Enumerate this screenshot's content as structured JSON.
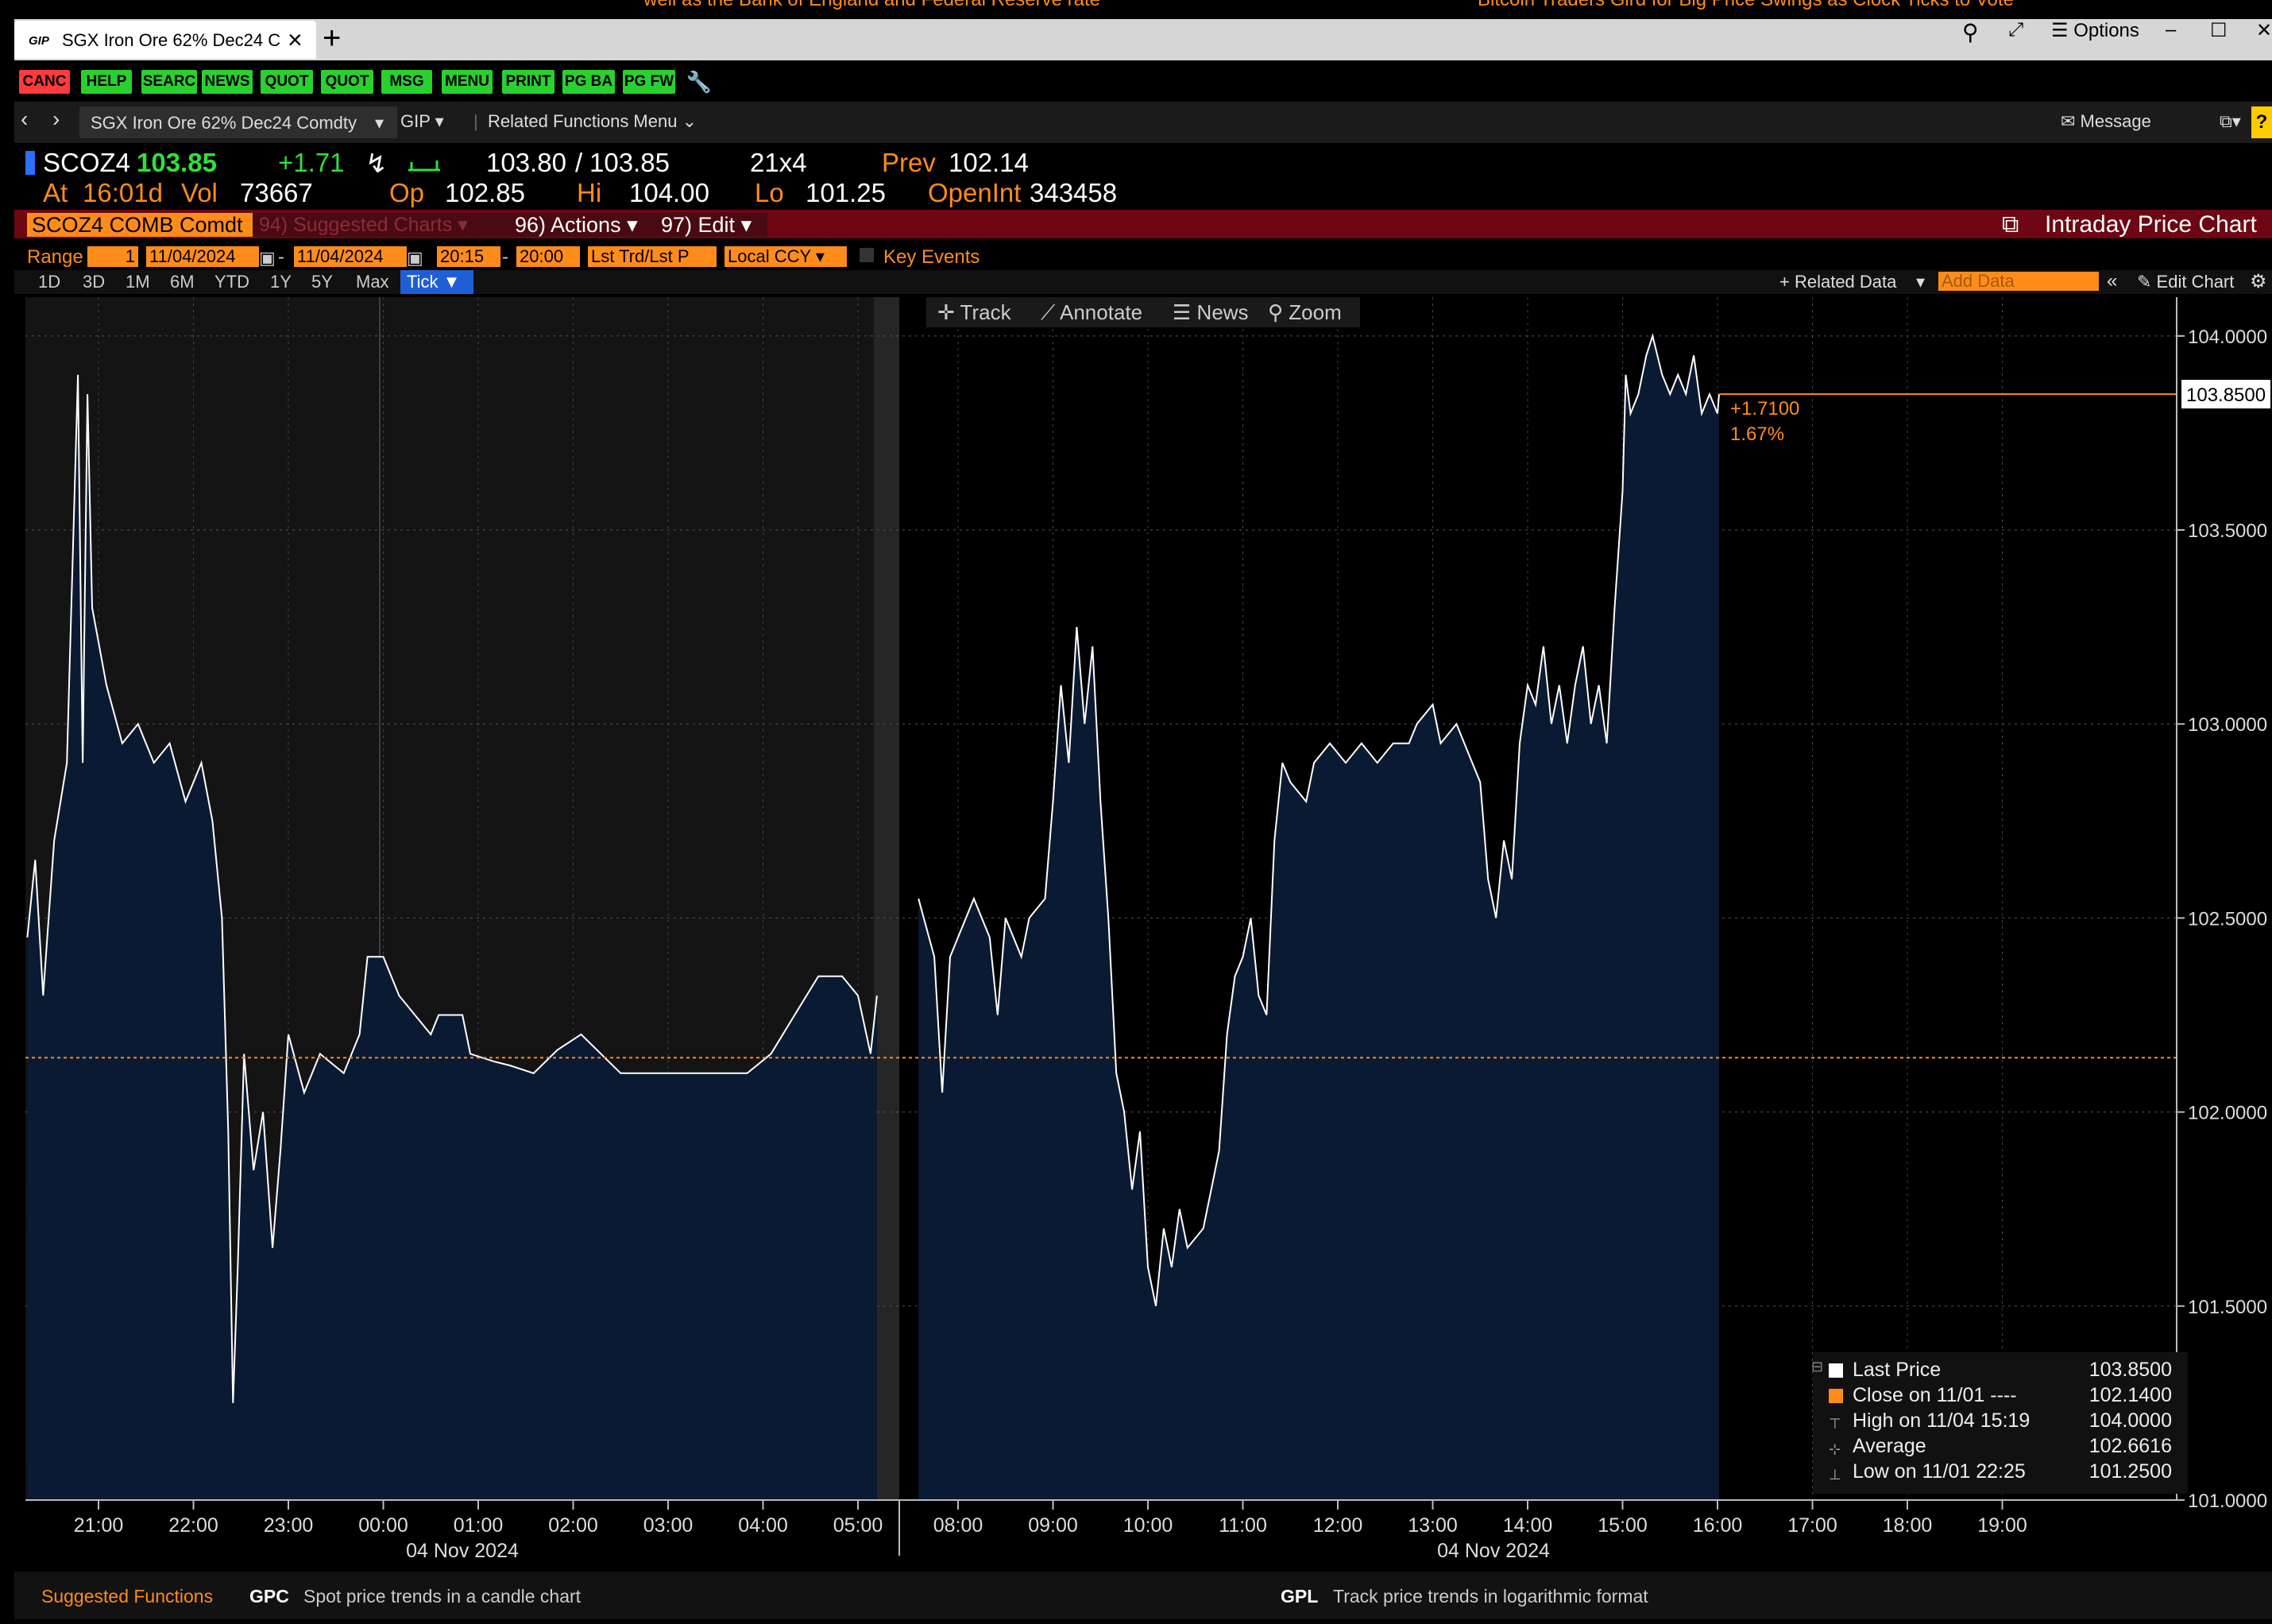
{
  "ticker": {
    "left_text": "well as the Bank of England and Federal Reserve rate",
    "right_text": "Bitcoin Traders Gird for Big Price Swings as Clock Ticks to Vote"
  },
  "tab": {
    "logo": "GIP",
    "title": "SGX Iron Ore 62% Dec24 C",
    "close": "×",
    "new_tab": "+"
  },
  "window_controls": {
    "options_label": "Options"
  },
  "toolbar": {
    "buttons": [
      {
        "label": "CANC",
        "color": "#ff3b3b"
      },
      {
        "label": "HELP",
        "color": "#29d12f"
      },
      {
        "label": "SEARC",
        "color": "#29d12f"
      },
      {
        "label": "NEWS",
        "color": "#29d12f"
      },
      {
        "label": "QUOT",
        "color": "#29d12f"
      },
      {
        "label": "QUOT",
        "color": "#29d12f"
      },
      {
        "label": "MSG",
        "color": "#29d12f"
      },
      {
        "label": "MENU",
        "color": "#29d12f"
      },
      {
        "label": "PRINT",
        "color": "#29d12f"
      },
      {
        "label": "PG BA",
        "color": "#29d12f"
      },
      {
        "label": "PG FW",
        "color": "#29d12f"
      }
    ]
  },
  "navbar": {
    "security": "SGX Iron Ore 62% Dec24 Comdty",
    "function": "GIP",
    "related": "Related Functions Menu",
    "message": "Message"
  },
  "quote": {
    "ticker": "SCOZ4",
    "last": "103.85",
    "change": "+1.71",
    "bid": "103.80",
    "ask": "103.85",
    "size": "21x4",
    "prev_label": "Prev",
    "prev": "102.14",
    "at_label": "At",
    "at_time": "16:01d",
    "vol_label": "Vol",
    "vol": "73667",
    "op_label": "Op",
    "op": "102.85",
    "hi_label": "Hi",
    "hi": "104.00",
    "lo_label": "Lo",
    "lo": "101.25",
    "oi_label": "OpenInt",
    "oi": "343458"
  },
  "actionbar": {
    "security_field": "SCOZ4 COMB Comdt",
    "suggested": "94) Suggested Charts",
    "actions": "96) Actions",
    "edit": "97) Edit",
    "title": "Intraday Price Chart"
  },
  "rangebar": {
    "range_label": "Range",
    "range_val": "1",
    "date_from": "11/04/2024",
    "date_to": "11/04/2024",
    "time_from": "20:15",
    "time_to": "20:00",
    "price_type": "Lst Trd/Lst P",
    "currency": "Local CCY",
    "key_events": "Key Events"
  },
  "periods": [
    "1D",
    "3D",
    "1M",
    "6M",
    "YTD",
    "1Y",
    "5Y",
    "Max"
  ],
  "tick_label": "Tick",
  "chart_tools": {
    "related_data": "+ Related Data",
    "add_data": "Add Data",
    "edit_chart": "Edit Chart",
    "track": "Track",
    "annotate": "Annotate",
    "news": "News",
    "zoom": "Zoom"
  },
  "colors": {
    "accent_orange": "#ff8c1a",
    "area_fill": "#0a1a33",
    "price_line": "#ffffff",
    "up_green": "#2fe03a",
    "action_bar": "#6e0613"
  },
  "chart_data": {
    "type": "area",
    "ylim": [
      101.0,
      104.1
    ],
    "y_ticks": [
      "104.0000",
      "103.5000",
      "103.0000",
      "102.5000",
      "102.0000",
      "101.5000",
      "101.0000"
    ],
    "x_ticks_session1": [
      "21:00",
      "22:00",
      "23:00",
      "00:00",
      "01:00",
      "02:00",
      "03:00",
      "04:00",
      "05:00"
    ],
    "x_ticks_session2": [
      "08:00",
      "09:00",
      "10:00",
      "11:00",
      "12:00",
      "13:00",
      "14:00",
      "15:00",
      "16:00",
      "17:00",
      "18:00",
      "19:00"
    ],
    "date_labels": [
      "04 Nov 2024",
      "04 Nov 2024"
    ],
    "prev_close": 102.14,
    "last_price_label": "103.8500",
    "change_label": "+1.7100",
    "change_pct_label": "1.67%",
    "series": [
      {
        "name": "Last Price",
        "session1": [
          [
            "20:15",
            102.45
          ],
          [
            "20:20",
            102.65
          ],
          [
            "20:25",
            102.3
          ],
          [
            "20:32",
            102.7
          ],
          [
            "20:40",
            102.9
          ],
          [
            "20:47",
            103.9
          ],
          [
            "20:50",
            102.9
          ],
          [
            "20:53",
            103.85
          ],
          [
            "20:56",
            103.3
          ],
          [
            "21:05",
            103.1
          ],
          [
            "21:15",
            102.95
          ],
          [
            "21:25",
            103.0
          ],
          [
            "21:35",
            102.9
          ],
          [
            "21:45",
            102.95
          ],
          [
            "21:55",
            102.8
          ],
          [
            "22:05",
            102.9
          ],
          [
            "22:12",
            102.75
          ],
          [
            "22:18",
            102.5
          ],
          [
            "22:22",
            101.95
          ],
          [
            "22:25",
            101.25
          ],
          [
            "22:28",
            101.6
          ],
          [
            "22:32",
            102.15
          ],
          [
            "22:38",
            101.85
          ],
          [
            "22:44",
            102.0
          ],
          [
            "22:50",
            101.65
          ],
          [
            "22:55",
            101.9
          ],
          [
            "23:00",
            102.2
          ],
          [
            "23:10",
            102.05
          ],
          [
            "23:20",
            102.15
          ],
          [
            "23:35",
            102.1
          ],
          [
            "23:45",
            102.2
          ],
          [
            "23:50",
            102.4
          ],
          [
            "00:00",
            102.4
          ],
          [
            "00:10",
            102.3
          ],
          [
            "00:20",
            102.25
          ],
          [
            "00:30",
            102.2
          ],
          [
            "00:35",
            102.25
          ],
          [
            "00:50",
            102.25
          ],
          [
            "00:55",
            102.15
          ],
          [
            "01:10",
            102.13
          ],
          [
            "01:20",
            102.12
          ],
          [
            "01:35",
            102.1
          ],
          [
            "01:50",
            102.16
          ],
          [
            "02:05",
            102.2
          ],
          [
            "02:20",
            102.14
          ],
          [
            "02:30",
            102.1
          ],
          [
            "03:00",
            102.1
          ],
          [
            "03:30",
            102.1
          ],
          [
            "03:50",
            102.1
          ],
          [
            "04:05",
            102.15
          ],
          [
            "04:20",
            102.25
          ],
          [
            "04:35",
            102.35
          ],
          [
            "04:50",
            102.35
          ],
          [
            "05:00",
            102.3
          ],
          [
            "05:08",
            102.15
          ],
          [
            "05:12",
            102.3
          ]
        ],
        "session2": [
          [
            "07:35",
            102.55
          ],
          [
            "07:45",
            102.4
          ],
          [
            "07:50",
            102.05
          ],
          [
            "07:55",
            102.4
          ],
          [
            "08:00",
            102.45
          ],
          [
            "08:10",
            102.55
          ],
          [
            "08:20",
            102.45
          ],
          [
            "08:25",
            102.25
          ],
          [
            "08:30",
            102.5
          ],
          [
            "08:40",
            102.4
          ],
          [
            "08:45",
            102.5
          ],
          [
            "08:55",
            102.55
          ],
          [
            "09:00",
            102.8
          ],
          [
            "09:05",
            103.1
          ],
          [
            "09:10",
            102.9
          ],
          [
            "09:15",
            103.25
          ],
          [
            "09:20",
            103.0
          ],
          [
            "09:25",
            103.2
          ],
          [
            "09:30",
            102.8
          ],
          [
            "09:35",
            102.5
          ],
          [
            "09:40",
            102.1
          ],
          [
            "09:45",
            102.0
          ],
          [
            "09:50",
            101.8
          ],
          [
            "09:55",
            101.95
          ],
          [
            "10:00",
            101.6
          ],
          [
            "10:05",
            101.5
          ],
          [
            "10:10",
            101.7
          ],
          [
            "10:15",
            101.6
          ],
          [
            "10:20",
            101.75
          ],
          [
            "10:25",
            101.65
          ],
          [
            "10:35",
            101.7
          ],
          [
            "10:40",
            101.8
          ],
          [
            "10:45",
            101.9
          ],
          [
            "10:50",
            102.2
          ],
          [
            "10:55",
            102.35
          ],
          [
            "11:00",
            102.4
          ],
          [
            "11:05",
            102.5
          ],
          [
            "11:10",
            102.3
          ],
          [
            "11:15",
            102.25
          ],
          [
            "11:20",
            102.7
          ],
          [
            "11:25",
            102.9
          ],
          [
            "11:30",
            102.85
          ],
          [
            "11:40",
            102.8
          ],
          [
            "11:45",
            102.9
          ],
          [
            "11:55",
            102.95
          ],
          [
            "12:05",
            102.9
          ],
          [
            "12:15",
            102.95
          ],
          [
            "12:25",
            102.9
          ],
          [
            "12:35",
            102.95
          ],
          [
            "12:45",
            102.95
          ],
          [
            "12:50",
            103.0
          ],
          [
            "13:00",
            103.05
          ],
          [
            "13:05",
            102.95
          ],
          [
            "13:15",
            103.0
          ],
          [
            "13:25",
            102.9
          ],
          [
            "13:30",
            102.85
          ],
          [
            "13:35",
            102.6
          ],
          [
            "13:40",
            102.5
          ],
          [
            "13:45",
            102.7
          ],
          [
            "13:50",
            102.6
          ],
          [
            "13:55",
            102.95
          ],
          [
            "14:00",
            103.1
          ],
          [
            "14:05",
            103.05
          ],
          [
            "14:10",
            103.2
          ],
          [
            "14:15",
            103.0
          ],
          [
            "14:20",
            103.1
          ],
          [
            "14:25",
            102.95
          ],
          [
            "14:30",
            103.1
          ],
          [
            "14:35",
            103.2
          ],
          [
            "14:40",
            103.0
          ],
          [
            "14:45",
            103.1
          ],
          [
            "14:50",
            102.95
          ],
          [
            "14:55",
            103.3
          ],
          [
            "15:00",
            103.6
          ],
          [
            "15:02",
            103.9
          ],
          [
            "15:05",
            103.8
          ],
          [
            "15:10",
            103.85
          ],
          [
            "15:15",
            103.95
          ],
          [
            "15:19",
            104.0
          ],
          [
            "15:25",
            103.9
          ],
          [
            "15:30",
            103.85
          ],
          [
            "15:35",
            103.9
          ],
          [
            "15:40",
            103.85
          ],
          [
            "15:45",
            103.95
          ],
          [
            "15:50",
            103.8
          ],
          [
            "15:55",
            103.85
          ],
          [
            "16:00",
            103.8
          ],
          [
            "16:01",
            103.85
          ]
        ]
      }
    ]
  },
  "legend": {
    "rows": [
      {
        "label": "Last Price",
        "value": "103.8500"
      },
      {
        "label": "Close on 11/01 ----",
        "value": "102.1400"
      },
      {
        "label": "High on 11/04 15:19",
        "value": "104.0000"
      },
      {
        "label": "Average",
        "value": "102.6616"
      },
      {
        "label": "Low on 11/01 22:25",
        "value": "101.2500"
      }
    ]
  },
  "bottom": {
    "suggested": "Suggested Functions",
    "gpc_code": "GPC",
    "gpc_desc": "Spot price trends in a candle chart",
    "gpl_code": "GPL",
    "gpl_desc": "Track price trends in logarithmic format"
  }
}
